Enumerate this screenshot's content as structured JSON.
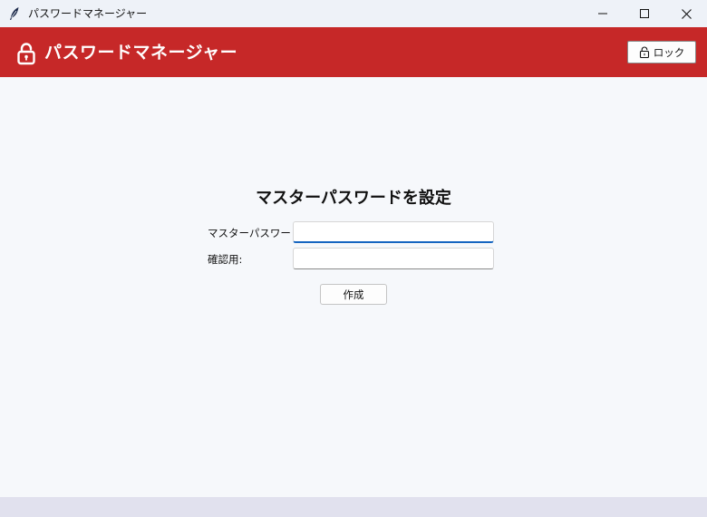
{
  "window": {
    "title": "パスワードマネージャー",
    "icon": "feather-icon",
    "controls": [
      "minimize-icon",
      "maximize-icon",
      "close-icon"
    ]
  },
  "header": {
    "title": "パスワードマネージャー",
    "icon": "lock-icon",
    "lock_button_label": "ロック",
    "background_color": "#c62828"
  },
  "setup": {
    "title": "マスターパスワードを設定",
    "master_label": "マスターパスワード:",
    "master_value": "",
    "confirm_label": "確認用:",
    "confirm_value": "",
    "create_button_label": "作成"
  },
  "colors": {
    "accent": "#1565c0",
    "page_background": "#f6f8fb"
  }
}
